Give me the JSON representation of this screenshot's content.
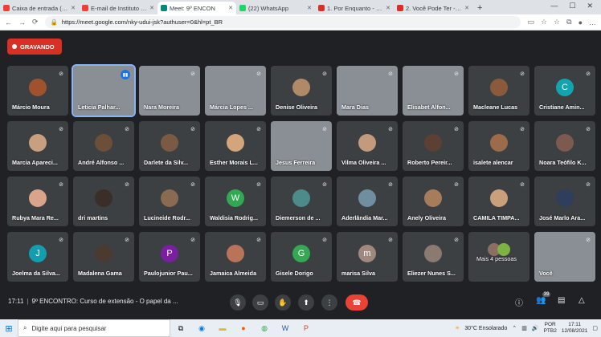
{
  "browser": {
    "tabs": [
      {
        "label": "Caixa de entrada (2.1(",
        "color": "#ea4335",
        "active": false
      },
      {
        "label": "E-mail de Instituto Fe",
        "color": "#ea4335",
        "active": false
      },
      {
        "label": "Meet: 9º ENCON",
        "color": "#00897b",
        "active": true
      },
      {
        "label": "(22) WhatsApp",
        "color": "#25d366",
        "active": false
      },
      {
        "label": "1. Por Enquanto - Cá",
        "color": "#d93025",
        "active": false
      },
      {
        "label": "2. Você Pode Ter - Ara",
        "color": "#d93025",
        "active": false
      }
    ],
    "new_tab": "+",
    "url": "https://meet.google.com/nky-udui-jsk?authuser=0&hl=pt_BR"
  },
  "meet": {
    "recording_label": "GRAVANDO",
    "participants": [
      {
        "name": "Márcio Moura",
        "type": "avatar",
        "color": "#a0522d"
      },
      {
        "name": "Leticia Palhar...",
        "type": "video",
        "speaking": true
      },
      {
        "name": "Nara Moreira",
        "type": "video"
      },
      {
        "name": "Márcia Lopes ...",
        "type": "video"
      },
      {
        "name": "Denise Oliveira",
        "type": "avatar",
        "color": "#b08968"
      },
      {
        "name": "Mara Dias",
        "type": "video"
      },
      {
        "name": "Elisabet Alfon...",
        "type": "video"
      },
      {
        "name": "Macleane Lucas",
        "type": "avatar",
        "color": "#8b5a3c"
      },
      {
        "name": "Cristiane Amin...",
        "type": "letter",
        "letter": "C",
        "color": "#12a4af"
      },
      {
        "name": "Marcia Apareci...",
        "type": "avatar",
        "color": "#c8a080"
      },
      {
        "name": "André Alfonso ...",
        "type": "avatar",
        "color": "#6b4f3a"
      },
      {
        "name": "Darlete da Silv...",
        "type": "avatar",
        "color": "#7a5a44"
      },
      {
        "name": "Esther Morais L...",
        "type": "avatar",
        "color": "#d2a67a"
      },
      {
        "name": "Jesus Ferreira",
        "type": "video"
      },
      {
        "name": "Vilma Oliveira ...",
        "type": "avatar",
        "color": "#c49a7c"
      },
      {
        "name": "Roberto Pereir...",
        "type": "avatar",
        "color": "#5c4033"
      },
      {
        "name": "isalete alencar",
        "type": "avatar",
        "color": "#9b6b4b"
      },
      {
        "name": "Noara Teófilo K...",
        "type": "avatar",
        "color": "#7d5a4f"
      },
      {
        "name": "Rubya Mara Re...",
        "type": "avatar",
        "color": "#d9a48a"
      },
      {
        "name": "dri martins",
        "type": "avatar",
        "color": "#3a2e28"
      },
      {
        "name": "Lucineide Rodr...",
        "type": "avatar",
        "color": "#8a6a50"
      },
      {
        "name": "Waldisia Rodrig...",
        "type": "letter",
        "letter": "W",
        "color": "#33a852"
      },
      {
        "name": "Diemerson de ...",
        "type": "avatar",
        "color": "#4d8a8a"
      },
      {
        "name": "Aderlândia Mar...",
        "type": "avatar",
        "color": "#6f8fa0"
      },
      {
        "name": "Anely Oliveira",
        "type": "avatar",
        "color": "#a67c5b"
      },
      {
        "name": "CAMILA TIMPA...",
        "type": "avatar",
        "color": "#c9a07a"
      },
      {
        "name": "José Marlo Ara...",
        "type": "avatar",
        "color": "#2f3e5c"
      },
      {
        "name": "Joelma da Silva...",
        "type": "letter",
        "letter": "J",
        "color": "#129eaf"
      },
      {
        "name": "Madalena Gama",
        "type": "avatar",
        "color": "#4a3a30"
      },
      {
        "name": "Paulojunior Pau...",
        "type": "letter",
        "letter": "P",
        "color": "#7b1fa2"
      },
      {
        "name": "Jamaica Almeida",
        "type": "avatar",
        "color": "#b87358"
      },
      {
        "name": "Gisele Dorigo",
        "type": "letter",
        "letter": "G",
        "color": "#34a853"
      },
      {
        "name": "marisa Silva",
        "type": "letter",
        "letter": "m",
        "color": "#a1887f"
      },
      {
        "name": "Eliezer Nunes S...",
        "type": "avatar",
        "color": "#8a7a70"
      },
      {
        "name": "Mais 4 pessoas",
        "type": "more"
      },
      {
        "name": "Você",
        "type": "video"
      }
    ],
    "meeting_time": "17:11",
    "meeting_title": "9º ENCONTRO: Curso de extensão - O papel da ...",
    "people_count": "39"
  },
  "taskbar": {
    "search_placeholder": "Digite aqui para pesquisar",
    "weather": "30°C  Ensolarado",
    "lang": "POR",
    "lang2": "PTB2",
    "time": "17:11",
    "date": "12/08/2021"
  }
}
